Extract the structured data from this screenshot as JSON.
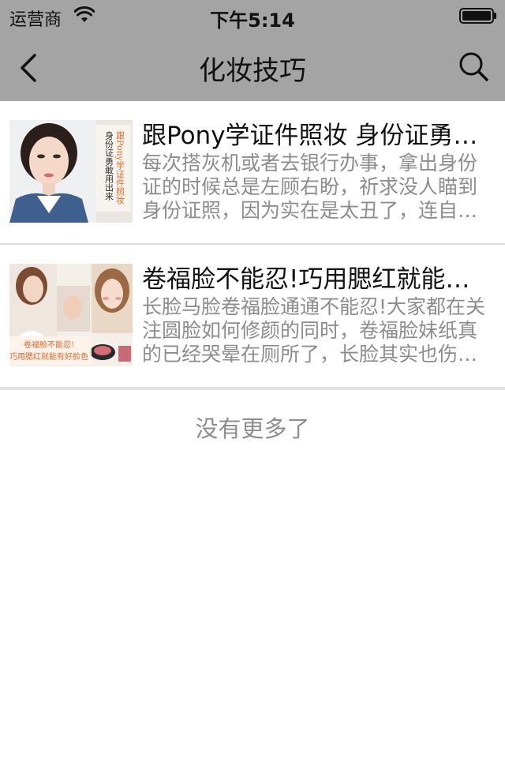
{
  "status_bar": {
    "carrier": "运营商",
    "time": "下午5:14"
  },
  "nav": {
    "title": "化妆技巧",
    "back_icon": "chevron-left-icon",
    "search_icon": "search-icon"
  },
  "articles": [
    {
      "title": "跟Pony学证件照妆 身份证勇敢用出来",
      "desc": "每次搭灰机或者去银行办事，拿出身份证的时候总是左顾右盼，祈求没人瞄到身份证照，因为实在是太丑了，连自己都不想多看一眼。",
      "thumb_text": "跟Pony学证件照妆 身份证勇敢用出来"
    },
    {
      "title": "卷福脸不能忍!巧用腮红就能有好脸色",
      "desc": "长脸马脸卷福脸通通不能忍!大家都在关注圆脸如何修颜的同时，卷福脸妹纸真的已经哭晕在厕所了，长脸其实也伤不起啊。",
      "thumb_text": "卷福脸不能忍! 巧用腮红就能有好脸色"
    }
  ],
  "footer": {
    "no_more": "没有更多了"
  },
  "colors": {
    "bar_bg": "#a4a4a4",
    "desc_text": "#8d8d8d",
    "divider": "#dcdcdc"
  }
}
